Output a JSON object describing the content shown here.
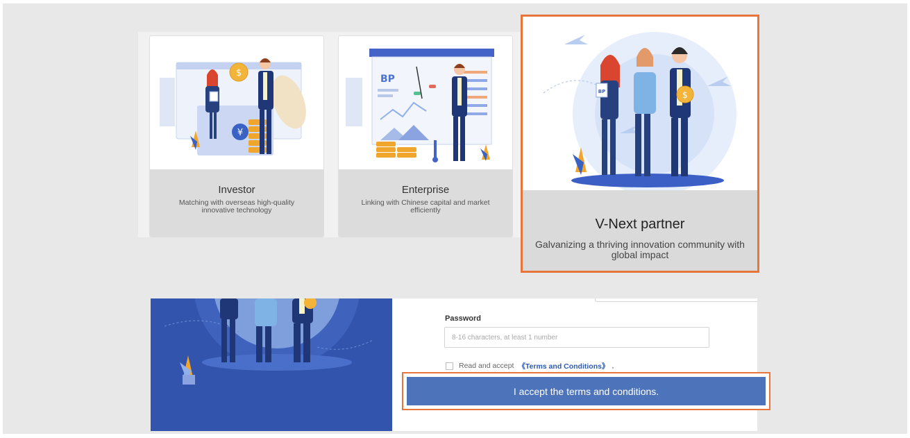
{
  "roles": [
    {
      "id": "investor",
      "title": "Investor",
      "subtitle": "Matching with overseas high-quality innovative technology"
    },
    {
      "id": "enterprise",
      "title": "Enterprise",
      "subtitle": "Linking with Chinese capital and market efficiently",
      "board_text": "BP"
    },
    {
      "id": "partner",
      "title": "V-Next partner",
      "subtitle": "Galvanizing a thriving innovation community with global impact",
      "selected": true
    }
  ],
  "illustration": {
    "investor_badge": "BP",
    "currency_symbol": "¥",
    "coin_symbol": "$"
  },
  "form": {
    "password_label": "Password",
    "password_placeholder": "8-16 characters, at least 1 number",
    "terms_prefix": "Read and accept",
    "terms_link": "《Terms and Conditions》",
    "terms_suffix": ",",
    "accept_button": "I accept the terms and conditions."
  },
  "colors": {
    "highlight": "#e8753a",
    "primary_button": "#4d74bb",
    "form_art_bg": "#3354ad",
    "link": "#2a5ab8"
  }
}
